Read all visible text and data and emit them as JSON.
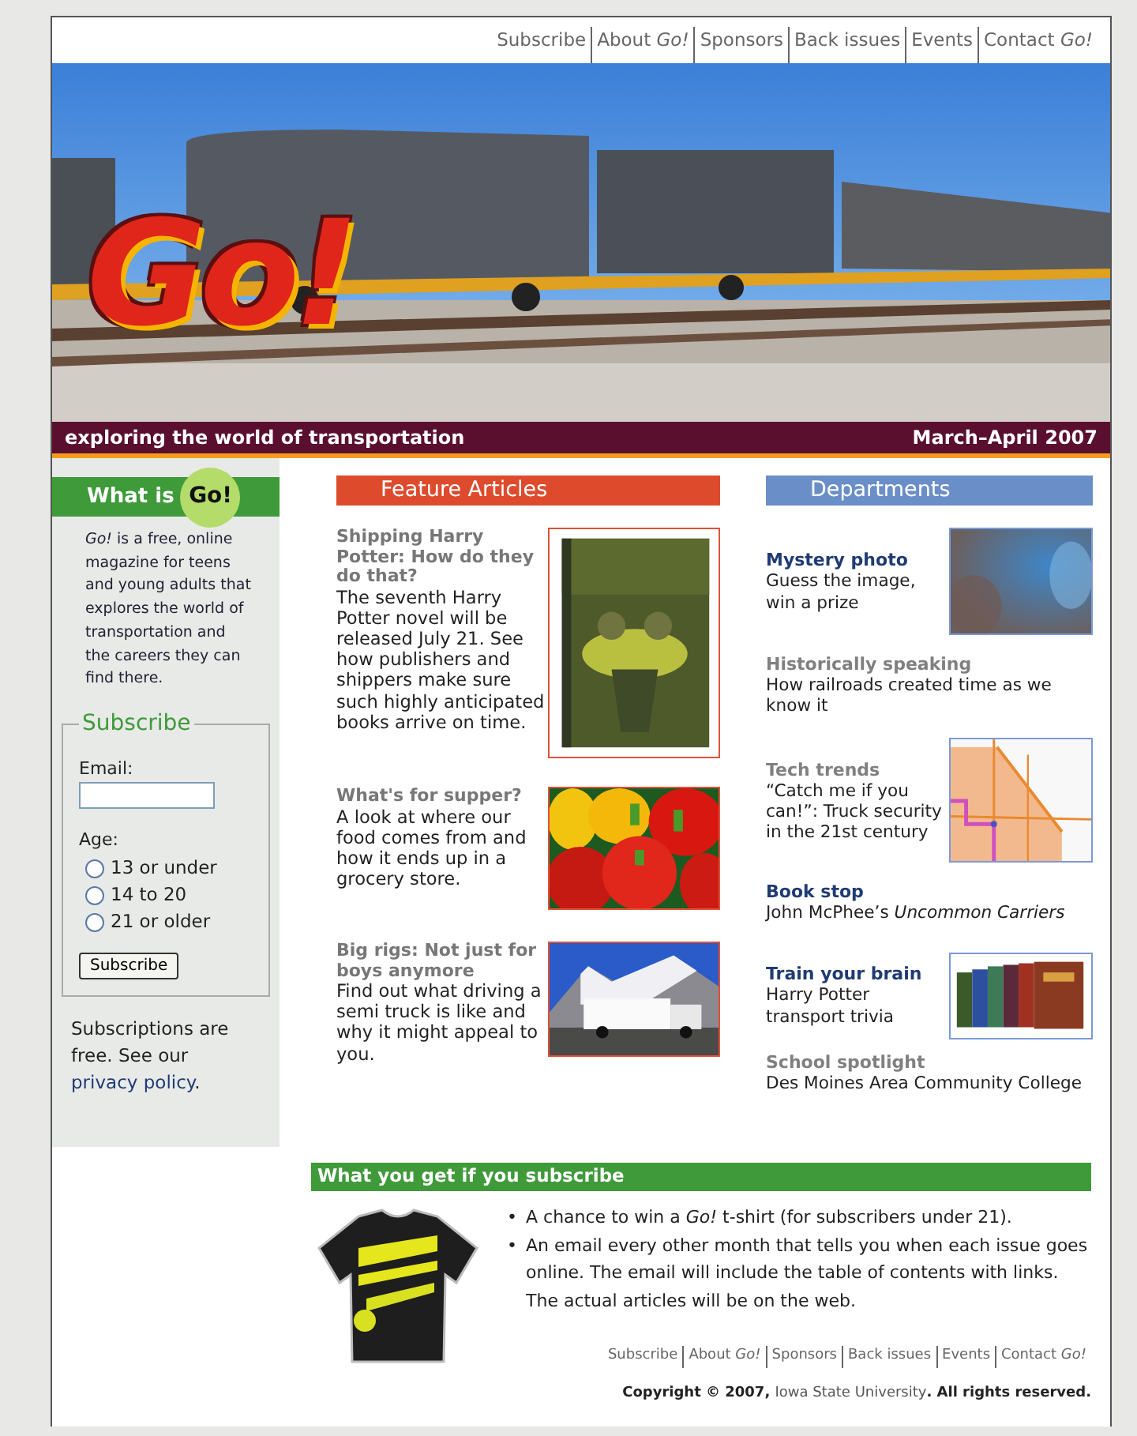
{
  "top_nav": [
    {
      "label": "Subscribe"
    },
    {
      "label": "About *Go!*"
    },
    {
      "label": "Sponsors"
    },
    {
      "label": "Back issues"
    },
    {
      "label": "Events"
    },
    {
      "label": "Contact *Go!*"
    }
  ],
  "banner": {
    "logo": "Go!",
    "tagline": "exploring the world of transportation",
    "issue": "March–April 2007"
  },
  "sidebar": {
    "heading": "What is",
    "logo": "Go!",
    "text": "*Go!* is a free, online magazine for teens and young adults that explores the world of transportation and the careers they can find there.",
    "form": {
      "legend": "Subscribe",
      "email_label": "Email:",
      "age_label": "Age:",
      "options": [
        {
          "label": "13 or under",
          "selected": false
        },
        {
          "label": "14 to 20",
          "selected": false
        },
        {
          "label": "21 or older",
          "selected": false
        }
      ],
      "button": "Subscribe"
    },
    "note": {
      "text": "Subscriptions are free. See our",
      "link": "privacy policy",
      "end": "."
    }
  },
  "features": {
    "heading": "Feature Articles",
    "articles": [
      {
        "title": "Shipping Harry Potter: How do they do that?",
        "text": "The seventh Harry Potter novel will be released July 21. See how publishers and shippers make sure such highly anticipated books arrive on time."
      },
      {
        "title": "What's for supper?",
        "text": "A look at where our food comes from and how it ends up in a grocery store."
      },
      {
        "title": "Big rigs: Not just for boys anymore",
        "text": "Find out what driving a semi truck is like and why it might appeal to you."
      }
    ]
  },
  "departments": {
    "heading": "Departments",
    "items": [
      {
        "kind": "with-picture",
        "title": "Mystery photo",
        "color": "#1f3b73",
        "text": "Guess the image, win a prize"
      },
      {
        "kind": "text",
        "title": "Historically speaking",
        "color": "#808080",
        "text": "How railroads created time as we know it"
      },
      {
        "kind": "with-picture",
        "title": "Tech trends",
        "color": "#808080",
        "text": "“Catch me if you can!”: Truck security in the 21st century"
      },
      {
        "kind": "text",
        "title": "Book stop",
        "color": "#1f3b73",
        "text": "John McPhee’s *Uncommon Carriers*"
      },
      {
        "kind": "with-picture",
        "title": "Train your brain",
        "color": "#1f3b73",
        "text": "Harry Potter transport trivia"
      },
      {
        "kind": "text",
        "title": "School spotlight",
        "color": "#808080",
        "text": "Des Moines Area Community College"
      }
    ]
  },
  "subscribe_info": {
    "heading": "What you get if you subscribe",
    "bullets": [
      {
        "marker": "•",
        "text": "A chance to win a *Go!* t-shirt (for subscribers under 21)."
      },
      {
        "marker": "•",
        "text": "An email every other month that tells you when each issue goes online. The email will include the table of contents with links. The actual articles will be on the web."
      }
    ]
  },
  "footer_nav": [
    {
      "label": "Subscribe"
    },
    {
      "label": "About *Go!*"
    },
    {
      "label": "Sponsors"
    },
    {
      "label": "Back issues"
    },
    {
      "label": "Events"
    },
    {
      "label": "Contact *Go!*"
    }
  ],
  "copyright": {
    "before": "Copyright © 2007,",
    "link": "Iowa State University",
    "after": ". All rights reserved."
  }
}
